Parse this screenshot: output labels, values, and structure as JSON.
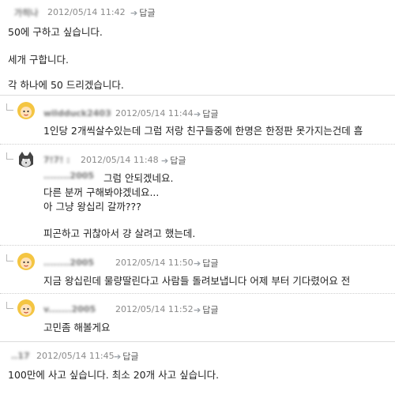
{
  "comments": [
    {
      "username": "가히나",
      "timestamp": "2012/05/14 11:42",
      "reply_label": "답글",
      "lines": [
        "50에 구하고 싶습니다.",
        "세개 구합니다.",
        "각 하나에 50 드리겠습니다."
      ]
    },
    {
      "username": "wildduck2403",
      "timestamp": "2012/05/14 11:44",
      "reply_label": "답글",
      "avatar": "girl-avatar-icon",
      "lines": [
        "1인당 2개씩살수있는데 그럼 저랑 친구들중에 한명은 한정판 못가지는건데 흠"
      ]
    },
    {
      "username": "7!7! :",
      "timestamp": "2012/05/14 11:48",
      "reply_label": "답글",
      "avatar": "cat-avatar-icon",
      "mention": "........2005",
      "lines": [
        "그럼 안되겠네요.",
        "다른 분꺼 구해봐야겠네요...",
        "아 그냥 왕십리 갈까???",
        "피곤하고 귀찮아서 걍 살려고 했는데."
      ]
    },
    {
      "username": "........2005",
      "timestamp": "2012/05/14 11:50",
      "reply_label": "답글",
      "avatar": "girl-avatar-icon",
      "lines": [
        "지금 왕십린데 물량딸린다고 사람들 돌려보냅니다 어제 부터 기다렸어요 전"
      ]
    },
    {
      "username": "v.......2005",
      "timestamp": "2012/05/14 11:52",
      "reply_label": "답글",
      "avatar": "girl-avatar-icon",
      "lines": [
        "고민좀 해볼게요"
      ]
    },
    {
      "username": "..17",
      "timestamp": "2012/05/14 11:45",
      "reply_label": "답글",
      "lines": [
        "100만에 사고 싶습니다. 최소 20개 사고 싶습니다."
      ]
    }
  ]
}
